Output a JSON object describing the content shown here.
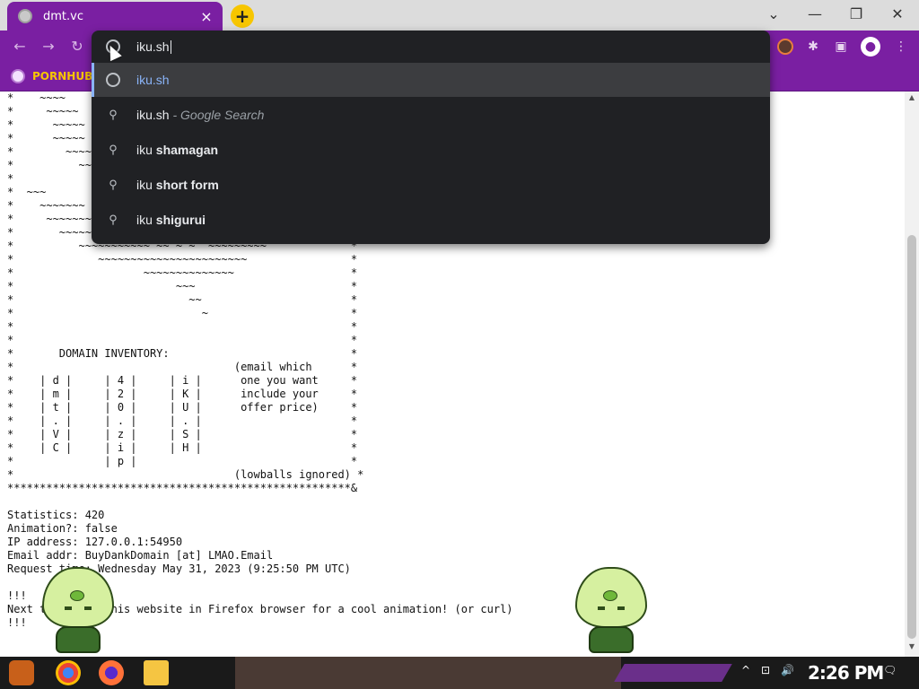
{
  "browser": {
    "tab": {
      "title": "dmt.vc",
      "close_glyph": "×",
      "icon": "globe-icon"
    },
    "new_tab_glyph": "+",
    "window_controls": {
      "chevron": "⌄",
      "minimize": "—",
      "restore": "❐",
      "close": "✕"
    },
    "nav": {
      "back": "←",
      "forward": "→",
      "reload": "↻"
    },
    "toolbar_icons": {
      "extensions": "✱",
      "sidebar": "▣",
      "profile": "●",
      "menu": "⋮"
    },
    "bookmark": {
      "label": "PORNHUB"
    }
  },
  "omnibox": {
    "input_value": "iku.sh",
    "suggestions": [
      {
        "icon": "globe-icon",
        "main": "iku.sh",
        "hint": ""
      },
      {
        "icon": "search-icon",
        "main": "iku.sh",
        "hint": " - Google Search"
      },
      {
        "icon": "search-icon",
        "prefix": "iku ",
        "main": "shamagan",
        "hint": ""
      },
      {
        "icon": "search-icon",
        "prefix": "iku ",
        "main": "short form",
        "hint": ""
      },
      {
        "icon": "search-icon",
        "prefix": "iku ",
        "main": "shigurui",
        "hint": ""
      }
    ]
  },
  "page": {
    "ascii_lines": [
      "*    ~~~~                                            *",
      "*     ~~~~~                                          *",
      "*      ~~~~~                                         *",
      "*      ~~~~~                                         *",
      "*        ~~~~                                        *",
      "*          ~~                                        *",
      "*                                                    *",
      "*  ~~~                                               *",
      "*    ~~~~~~~                                         *",
      "*     ~~~~~~~~                                       *",
      "*       ~~~~~~~~~~~~~~~  ~~~~~  ~~~~  ~~~~~~~~~~~~~  *",
      "*          ~~~~~~~~~~~ ~~ ~ ~  ~~~~~~~~~             *",
      "*             ~~~~~~~~~~~~~~~~~~~~~~~                *",
      "*                    ~~~~~~~~~~~~~~                  *",
      "*                         ~~~                        *",
      "*                           ~~                       *",
      "*                             ~                      *",
      "*                                                    *",
      "*                                                    *",
      "*       DOMAIN INVENTORY:                            *",
      "*                                  (email which      *",
      "*    | d |     | 4 |     | i |      one you want     *",
      "*    | m |     | 2 |     | K |      include your     *",
      "*    | t |     | 0 |     | U |      offer price)     *",
      "*    | . |     | . |     | . |                       *",
      "*    | V |     | z |     | S |                       *",
      "*    | C |     | i |     | H |                       *",
      "*              | p |                                 *",
      "*                                  (lowballs ignored) *",
      "*****************************************************&",
      "",
      "Statistics: 420",
      "Animation?: false",
      "IP address: 127.0.0.1:54950",
      "Email addr: BuyDankDomain [at] LMAO.Email",
      "Request time: Wednesday May 31, 2023 (9:25:50 PM UTC)",
      "",
      "!!!",
      "Next time view this website in Firefox browser for a cool animation! (or curl)",
      "!!!"
    ]
  },
  "taskbar": {
    "apps": [
      "start-icon",
      "chrome-icon",
      "firefox-icon",
      "file-explorer-icon"
    ],
    "tray": {
      "chevron": "^",
      "network": "⊡",
      "volume": "🔊",
      "notifications": "🗨"
    },
    "clock": "2:26 PM"
  },
  "colors": {
    "accent": "#7a1fa2",
    "omnibox_bg": "#202124",
    "link_blue": "#8ab4f8",
    "bookmark_gold": "#f7c600"
  }
}
